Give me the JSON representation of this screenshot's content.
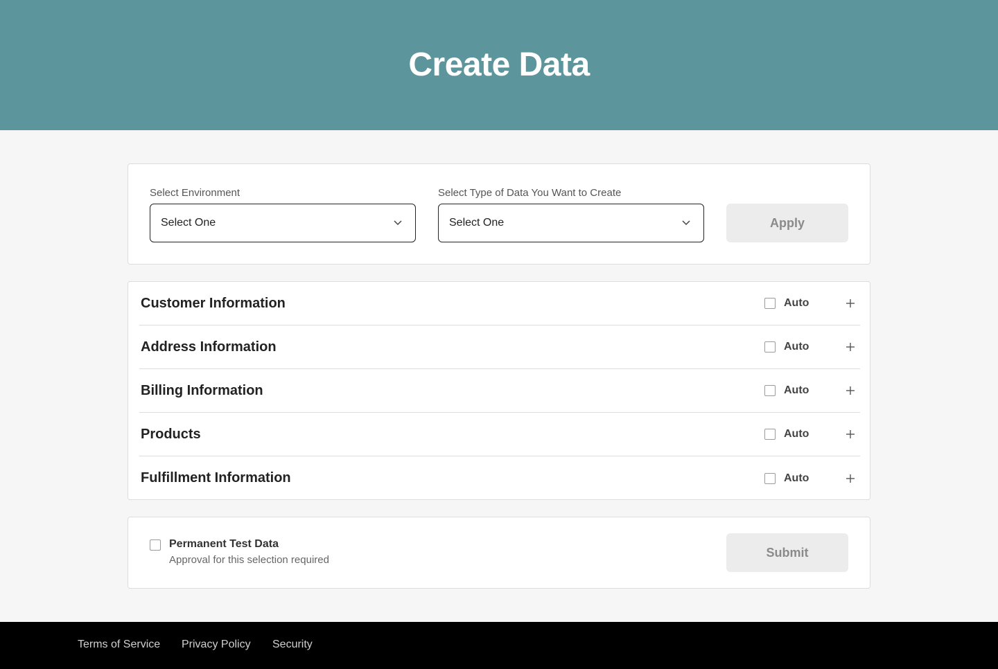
{
  "header": {
    "title": "Create Data"
  },
  "filters": {
    "environment": {
      "label": "Select Environment",
      "value": "Select One"
    },
    "data_type": {
      "label": "Select Type of Data You Want to Create",
      "value": "Select One"
    },
    "apply_label": "Apply"
  },
  "sections": [
    {
      "title": "Customer Information",
      "auto_label": "Auto",
      "auto_checked": false
    },
    {
      "title": "Address Information",
      "auto_label": "Auto",
      "auto_checked": false
    },
    {
      "title": "Billing Information",
      "auto_label": "Auto",
      "auto_checked": false
    },
    {
      "title": "Products",
      "auto_label": "Auto",
      "auto_checked": false
    },
    {
      "title": "Fulfillment Information",
      "auto_label": "Auto",
      "auto_checked": false
    }
  ],
  "permanent": {
    "title": "Permanent Test Data",
    "note": "Approval for this selection required",
    "checked": false
  },
  "submit_label": "Submit",
  "footer": {
    "links": [
      "Terms of Service",
      "Privacy Policy",
      "Security"
    ]
  },
  "colors": {
    "header_bg": "#5c959c",
    "page_bg": "#f6f6f6",
    "footer_bg": "#000000",
    "disabled_button_bg": "#ececec"
  },
  "icons": {
    "select_chevron": "chevron-down-icon",
    "section_expand": "plus-icon"
  }
}
